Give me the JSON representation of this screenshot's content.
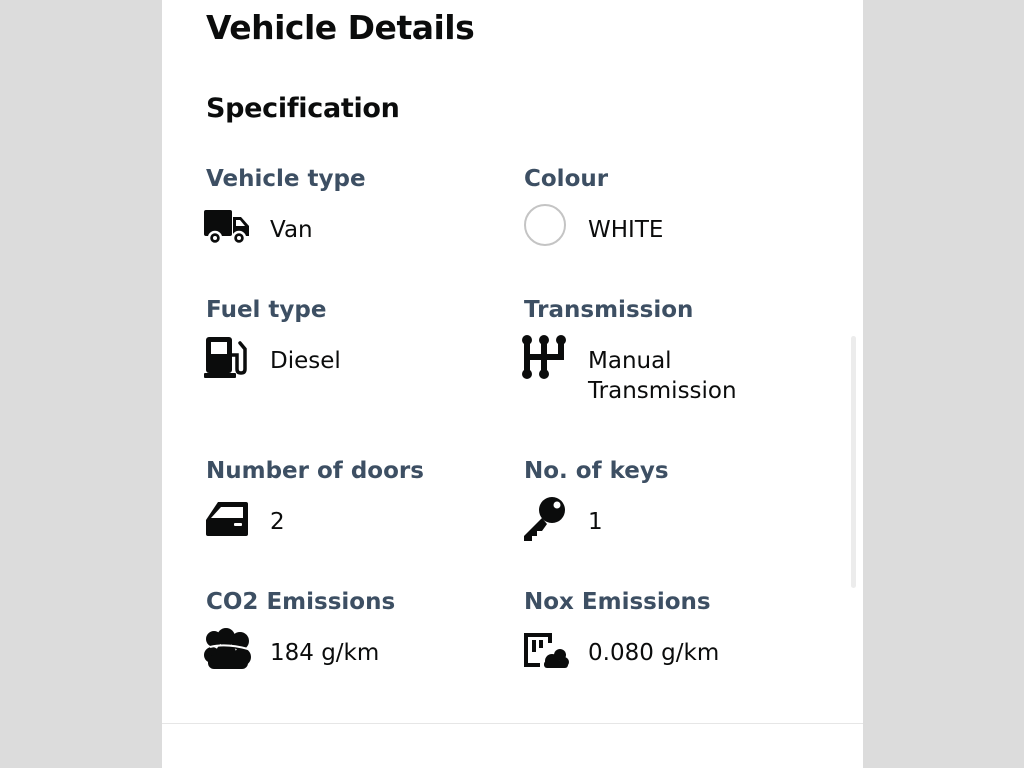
{
  "page": {
    "title": "Vehicle Details"
  },
  "specification": {
    "title": "Specification",
    "items": [
      {
        "label": "Vehicle type",
        "value": "Van",
        "icon": "van-icon"
      },
      {
        "label": "Colour",
        "value": "WHITE",
        "icon": "colour-swatch",
        "swatch_color": "#ffffff"
      },
      {
        "label": "Fuel type",
        "value": "Diesel",
        "icon": "fuel-pump-icon"
      },
      {
        "label": "Transmission",
        "value": "Manual Transmission",
        "icon": "gear-shift-icon"
      },
      {
        "label": "Number of doors",
        "value": "2",
        "icon": "car-door-icon"
      },
      {
        "label": "No. of keys",
        "value": "1",
        "icon": "key-icon"
      },
      {
        "label": "CO2 Emissions",
        "value": "184 g/km",
        "icon": "cloud-icon"
      },
      {
        "label": "Nox Emissions",
        "value": "0.080 g/km",
        "icon": "factory-emissions-icon"
      }
    ]
  },
  "colors": {
    "label": "#3d4f63",
    "text": "#0b0c0c",
    "background": "#dcdcdc",
    "panel": "#ffffff"
  }
}
